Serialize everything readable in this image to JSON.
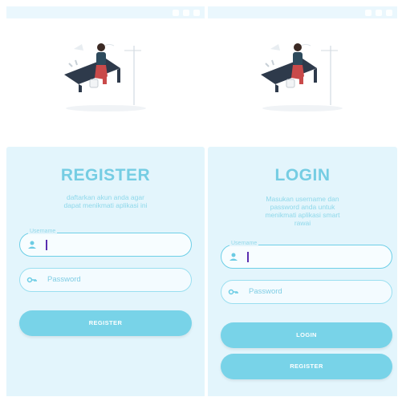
{
  "register_screen": {
    "title": "REGISTER",
    "subtitle_line1": "daftarkan akun anda agar",
    "subtitle_line2": "dapat menikmati aplikasi ini",
    "username_label": "Username",
    "password_placeholder": "Password",
    "register_button": "REGISTER"
  },
  "login_screen": {
    "title": "LOGIN",
    "subtitle_line1": "Masukan username dan",
    "subtitle_line2": "password anda untuk",
    "subtitle_line3": "menikmati aplikasi smart",
    "subtitle_line4": "rawai",
    "username_label": "Username",
    "password_placeholder": "Password",
    "login_button": "LOGIN",
    "register_button": "REGISTER"
  },
  "icons": {
    "username_icon": "user-icon",
    "password_icon": "key-icon",
    "illustration": "fishing-person-illustration"
  },
  "colors": {
    "accent": "#75cde3",
    "panel_background": "#e3f5fc",
    "button": "#78d3e8",
    "cursor": "#5a2fb0"
  }
}
